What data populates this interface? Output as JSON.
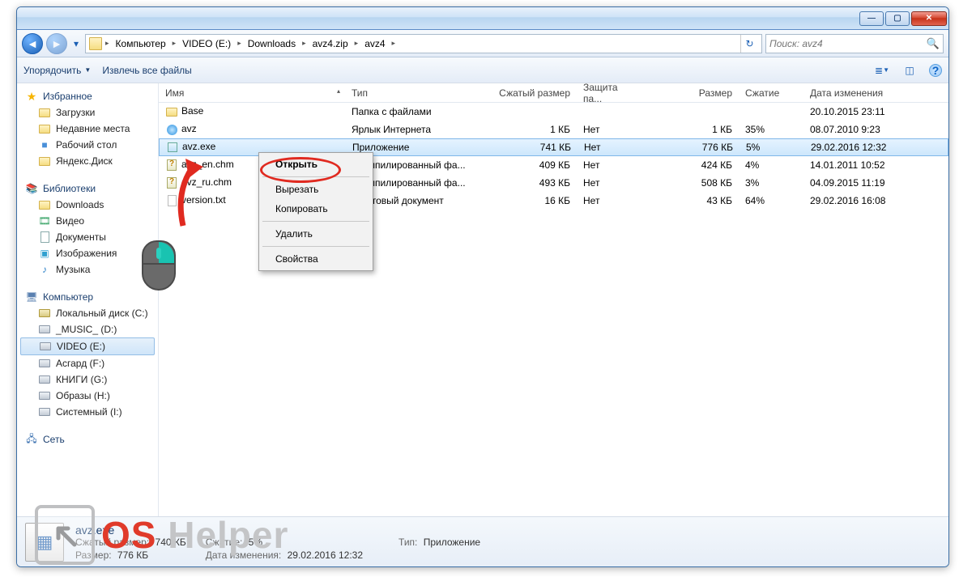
{
  "breadcrumbs": [
    "Компьютер",
    "VIDEO (E:)",
    "Downloads",
    "avz4.zip",
    "avz4"
  ],
  "search_placeholder": "Поиск: avz4",
  "toolbar": {
    "organize": "Упорядочить",
    "extract": "Извлечь все файлы"
  },
  "columns": {
    "name": "Имя",
    "type": "Тип",
    "compressed": "Сжатый размер",
    "protected": "Защита па...",
    "size": "Размер",
    "ratio": "Сжатие",
    "date": "Дата изменения"
  },
  "rows": [
    {
      "icon": "folder",
      "name": "Base",
      "type": "Папка с файлами",
      "comp": "",
      "prot": "",
      "size": "",
      "ratio": "",
      "date": "20.10.2015 23:11"
    },
    {
      "icon": "globe",
      "name": "avz",
      "type": "Ярлык Интернета",
      "comp": "1 КБ",
      "prot": "Нет",
      "size": "1 КБ",
      "ratio": "35%",
      "date": "08.07.2010 9:23"
    },
    {
      "icon": "exe",
      "name": "avz.exe",
      "type": "Приложение",
      "comp": "741 КБ",
      "prot": "Нет",
      "size": "776 КБ",
      "ratio": "5%",
      "date": "29.02.2016 12:32",
      "selected": true
    },
    {
      "icon": "chm",
      "name": "avz_en.chm",
      "type": "Скомпилированный фа...",
      "comp": "409 КБ",
      "prot": "Нет",
      "size": "424 КБ",
      "ratio": "4%",
      "date": "14.01.2011 10:52"
    },
    {
      "icon": "chm",
      "name": "avz_ru.chm",
      "type": "Скомпилированный фа...",
      "comp": "493 КБ",
      "prot": "Нет",
      "size": "508 КБ",
      "ratio": "3%",
      "date": "04.09.2015 11:19"
    },
    {
      "icon": "txt",
      "name": "version.txt",
      "type": "Текстовый документ",
      "comp": "16 КБ",
      "prot": "Нет",
      "size": "43 КБ",
      "ratio": "64%",
      "date": "29.02.2016 16:08"
    }
  ],
  "context_menu": {
    "open": "Открыть",
    "cut": "Вырезать",
    "copy": "Копировать",
    "delete": "Удалить",
    "properties": "Свойства"
  },
  "sidebar": {
    "favorites": "Избранное",
    "fav_items": [
      "Загрузки",
      "Недавние места",
      "Рабочий стол",
      "Яндекс.Диск"
    ],
    "libraries": "Библиотеки",
    "lib_items": [
      "Downloads",
      "Видео",
      "Документы",
      "Изображения",
      "Музыка"
    ],
    "computer": "Компьютер",
    "drives": [
      "Локальный диск (C:)",
      "_MUSIC_ (D:)",
      "VIDEO (E:)",
      "Асгард (F:)",
      "КНИГИ (G:)",
      "Образы (H:)",
      "Системный (I:)"
    ],
    "network": "Сеть"
  },
  "details": {
    "title": "avz.exe",
    "comp_lbl": "Сжатый размер:",
    "comp_val": "740 КБ",
    "size_lbl": "Размер:",
    "size_val": "776 КБ",
    "ratio_lbl": "Сжатие:",
    "ratio_val": "5%",
    "date_lbl": "Дата изменения:",
    "date_val": "29.02.2016 12:32",
    "type_lbl": "Тип:",
    "type_val": "Приложение"
  },
  "watermark": {
    "os": "OS",
    "helper": "Helper"
  }
}
